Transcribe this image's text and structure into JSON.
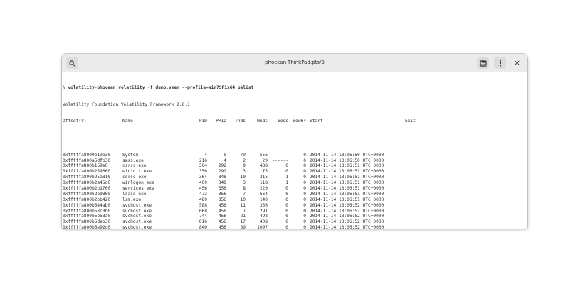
{
  "window": {
    "title": "phocean-ThinkPad:pts/3",
    "icons": {
      "search": "search-icon",
      "new_tab": "new-tab-icon",
      "menu": "vertical-dots-icon",
      "close": "close-icon"
    },
    "close_glyph": "×"
  },
  "terminal": {
    "prompt": "% ",
    "command": "volatility-phocean.volatility -f dump.vmem --profile=Win7SP1x64 pslist",
    "banner": "Volatility Foundation Volatility Framework 2.6.1",
    "headers": {
      "offset": "Offset(V)",
      "name": "Name",
      "pid": "PID",
      "ppid": "PPID",
      "thds": "Thds",
      "hnds": "Hnds",
      "sess": "Sess",
      "wow64": "Wow64",
      "start": "Start",
      "exit": "Exit"
    },
    "separators": {
      "offset": "------------------",
      "name": "--------------------",
      "pid": "------",
      "ppid": "------",
      "thds": "------",
      "hnds": "--------",
      "sess": "------",
      "wow64": "------",
      "start": "------------------------------",
      "exit": "------------------------------"
    },
    "rows": [
      {
        "offset": "0xfffffa8009e19b30",
        "name": "System",
        "pid": "4",
        "ppid": "0",
        "thds": "79",
        "hnds": "556",
        "sess": "------",
        "wow64": "0",
        "start": "2014-11-14 13:06:50 UTC+0000"
      },
      {
        "offset": "0xfffffa800a5dfb30",
        "name": "smss.exe",
        "pid": "216",
        "ppid": "4",
        "thds": "2",
        "hnds": "29",
        "sess": "------",
        "wow64": "0",
        "start": "2014-11-14 13:06:50 UTC+0000"
      },
      {
        "offset": "0xfffffa800b159e0",
        "name": "csrss.exe",
        "pid": "304",
        "ppid": "292",
        "thds": "9",
        "hnds": "488",
        "sess": "0",
        "wow64": "0",
        "start": "2014-11-14 13:06:51 UTC+0000"
      },
      {
        "offset": "0xfffffa800b259060",
        "name": "wininit.exe",
        "pid": "356",
        "ppid": "292",
        "thds": "3",
        "hnds": "75",
        "sess": "0",
        "wow64": "0",
        "start": "2014-11-14 13:06:51 UTC+0000"
      },
      {
        "offset": "0xfffffa800b25a810",
        "name": "csrss.exe",
        "pid": "364",
        "ppid": "348",
        "thds": "10",
        "hnds": "315",
        "sess": "1",
        "wow64": "0",
        "start": "2014-11-14 13:06:51 UTC+0000"
      },
      {
        "offset": "0xfffffa800b2a45d0",
        "name": "winlogon.exe",
        "pid": "400",
        "ppid": "348",
        "thds": "3",
        "hnds": "118",
        "sess": "1",
        "wow64": "0",
        "start": "2014-11-14 13:06:51 UTC+0000"
      },
      {
        "offset": "0xfffffa800b2b1700",
        "name": "services.exe",
        "pid": "456",
        "ppid": "356",
        "thds": "8",
        "hnds": "229",
        "sess": "0",
        "wow64": "0",
        "start": "2014-11-14 13:06:51 UTC+0000"
      },
      {
        "offset": "0xfffffa800b2bd800",
        "name": "lsass.exe",
        "pid": "472",
        "ppid": "356",
        "thds": "7",
        "hnds": "664",
        "sess": "0",
        "wow64": "0",
        "start": "2014-11-14 13:06:51 UTC+0000"
      },
      {
        "offset": "0xfffffa800b2bb420",
        "name": "lsm.exe",
        "pid": "480",
        "ppid": "356",
        "thds": "10",
        "hnds": "140",
        "sess": "0",
        "wow64": "0",
        "start": "2014-11-14 13:06:51 UTC+0000"
      },
      {
        "offset": "0xfffffa800b544ab0",
        "name": "svchost.exe",
        "pid": "588",
        "ppid": "456",
        "thds": "11",
        "hnds": "356",
        "sess": "0",
        "wow64": "0",
        "start": "2014-11-14 13:06:52 UTC+0000"
      },
      {
        "offset": "0xfffffa800b58c3b0",
        "name": "svchost.exe",
        "pid": "668",
        "ppid": "456",
        "thds": "7",
        "hnds": "291",
        "sess": "0",
        "wow64": "0",
        "start": "2014-11-14 13:06:52 UTC+0000"
      },
      {
        "offset": "0xfffffa800b5b53a0",
        "name": "svchost.exe",
        "pid": "744",
        "ppid": "456",
        "thds": "21",
        "hnds": "492",
        "sess": "0",
        "wow64": "0",
        "start": "2014-11-14 13:06:52 UTC+0000"
      },
      {
        "offset": "0xfffffa800b5deb30",
        "name": "svchost.exe",
        "pid": "816",
        "ppid": "456",
        "thds": "17",
        "hnds": "408",
        "sess": "0",
        "wow64": "0",
        "start": "2014-11-14 13:06:52 UTC+0000"
      },
      {
        "offset": "0xfffffa800b5e92c0",
        "name": "svchost.exe",
        "pid": "840",
        "ppid": "456",
        "thds": "39",
        "hnds": "1097",
        "sess": "0",
        "wow64": "0",
        "start": "2014-11-14 13:06:52 UTC+0000"
      },
      {
        "offset": "0xfffffa800b6177a0",
        "name": "audiodg.exe",
        "pid": "916",
        "ppid": "744",
        "thds": "4",
        "hnds": "123",
        "sess": "0",
        "wow64": "0",
        "start": "2014-11-14 13:06:52 UTC+0000"
      },
      {
        "offset": "0xfffffa800b656ab0",
        "name": "svchost.exe",
        "pid": "1000",
        "ppid": "456",
        "thds": "20",
        "hnds": "727",
        "sess": "0",
        "wow64": "0",
        "start": "2014-11-14 13:06:53 UTC+0000"
      },
      {
        "offset": "0xfffffa800b6b8670",
        "name": "svchost.exe",
        "pid": "752",
        "ppid": "456",
        "thds": "15",
        "hnds": "402",
        "sess": "0",
        "wow64": "0",
        "start": "2014-11-14 13:06:53 UTC+0000"
      },
      {
        "offset": "0xfffffa800b6fb4c0",
        "name": "spoolsv.exe",
        "pid": "1180",
        "ppid": "456",
        "thds": "12",
        "hnds": "314",
        "sess": "0",
        "wow64": "0",
        "start": "2014-11-14 13:06:53 UTC+0000"
      },
      {
        "offset": "0xfffffa800b717060",
        "name": "svchost.exe",
        "pid": "1128",
        "ppid": "456",
        "thds": "17",
        "hnds": "325",
        "sess": "0",
        "wow64": "0",
        "start": "2014-11-14 13:06:53 UTC+0000"
      }
    ]
  }
}
